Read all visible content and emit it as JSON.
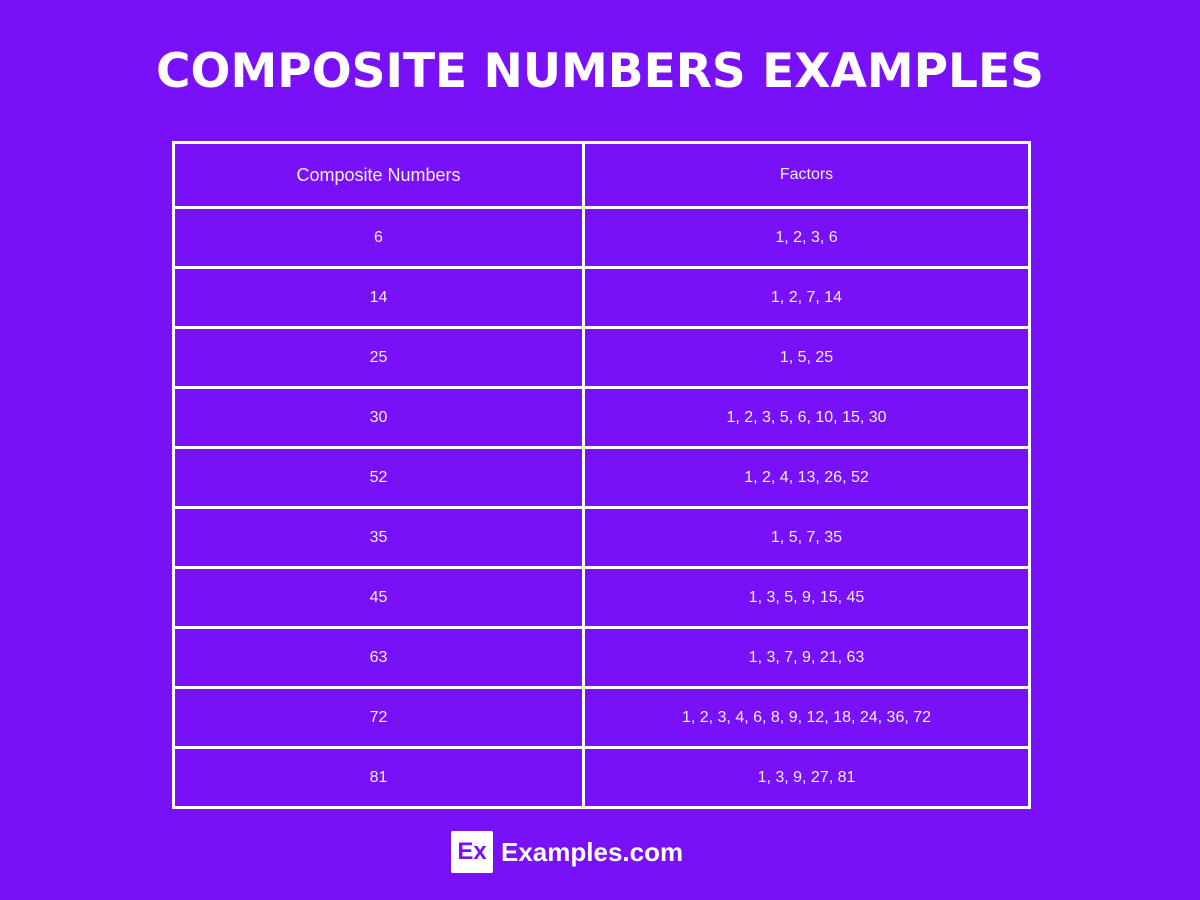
{
  "title": "COMPOSITE NUMBERS EXAMPLES",
  "table": {
    "headers": [
      "Composite Numbers",
      "Factors"
    ],
    "rows": [
      {
        "number": "6",
        "factors": "1, 2, 3, 6"
      },
      {
        "number": "14",
        "factors": "1, 2, 7, 14"
      },
      {
        "number": "25",
        "factors": "1, 5, 25"
      },
      {
        "number": "30",
        "factors": "1, 2, 3, 5, 6, 10, 15, 30"
      },
      {
        "number": "52",
        "factors": "1, 2, 4, 13, 26, 52"
      },
      {
        "number": "35",
        "factors": "1, 5, 7, 35"
      },
      {
        "number": "45",
        "factors": "1, 3, 5, 9, 15, 45"
      },
      {
        "number": "63",
        "factors": "1, 3, 7, 9, 21, 63"
      },
      {
        "number": "72",
        "factors": "1, 2, 3, 4, 6, 8, 9, 12, 18, 24, 36, 72"
      },
      {
        "number": "81",
        "factors": "1, 3, 9, 27, 81"
      }
    ]
  },
  "footer": {
    "logo_text": "Ex",
    "brand_name": "Examples.com"
  },
  "colors": {
    "background": "#7811f7",
    "text": "#ffffff"
  }
}
